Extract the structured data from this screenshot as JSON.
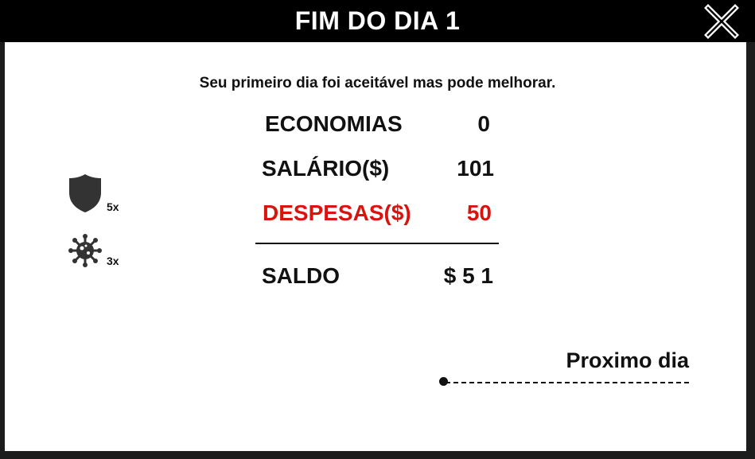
{
  "header": {
    "title": "FIM DO DIA 1",
    "close_icon": "close-x-icon"
  },
  "message": "Seu primeiro dia foi aceitável mas pode melhorar.",
  "summary": {
    "economias": {
      "label": "ECONOMIAS",
      "value": "0"
    },
    "salario": {
      "label": "SALÁRIO($)",
      "value": "101"
    },
    "despesas": {
      "label": "DESPESAS($)",
      "value": "50",
      "color": "#d9140e"
    },
    "saldo": {
      "label": "SALDO",
      "value": "$ 5 1"
    }
  },
  "stats": [
    {
      "icon": "shield-icon",
      "count": "5x"
    },
    {
      "icon": "virus-icon",
      "count": "3x"
    }
  ],
  "next_button": {
    "label": "Proximo dia"
  }
}
